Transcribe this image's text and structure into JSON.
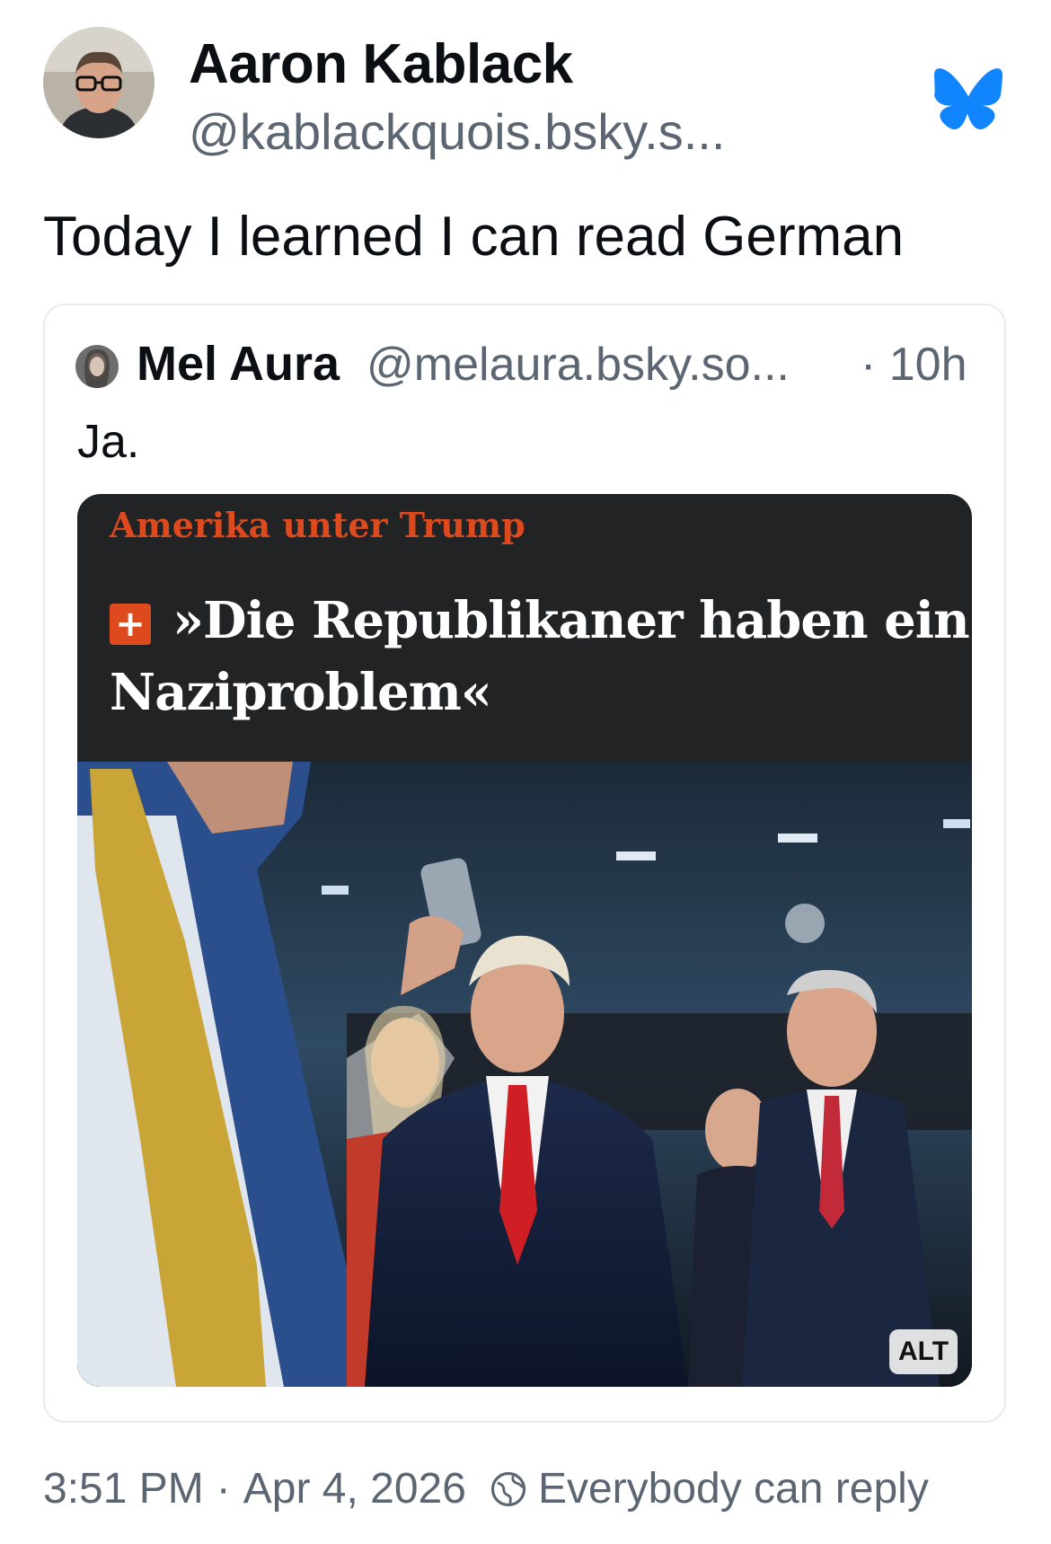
{
  "post": {
    "author_name": "Aaron Kablack",
    "author_handle": "@kablackquois.bsky.s...",
    "text": "Today I learned I can read German",
    "brand_icon": "bluesky-butterfly-icon",
    "brand_color": "#1185FE"
  },
  "quote": {
    "author_name": "Mel Aura",
    "author_handle": "@melaura.bsky.so...",
    "time": "· 10h",
    "text": "Ja.",
    "embed": {
      "kicker": "Amerika unter Trump",
      "badge": "+",
      "headline_line1": "»Die Republikaner haben ein",
      "headline_line2": "Naziproblem«",
      "alt_label": "ALT",
      "accent_color": "#DD4A1E"
    }
  },
  "footer": {
    "time": "3:51 PM",
    "separator": "·",
    "date": "Apr 4, 2026",
    "reply_setting": "Everybody can reply",
    "reply_icon": "globe-icon"
  }
}
